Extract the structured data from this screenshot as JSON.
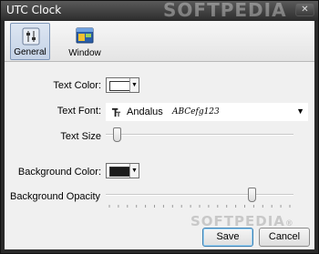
{
  "window": {
    "title": "UTC Clock",
    "close_label": "✕"
  },
  "toolbar": {
    "tabs": [
      {
        "label": "General",
        "icon": "settings-sliders-icon",
        "active": true
      },
      {
        "label": "Window",
        "icon": "window-layout-icon",
        "active": false
      }
    ]
  },
  "general": {
    "text_color_label": "Text Color:",
    "text_color_value": "#ffffff",
    "text_font_label": "Text Font:",
    "text_font_name": "Andalus",
    "text_font_preview": "ABCefg123",
    "text_size_label": "Text Size",
    "text_size_level": 0.04,
    "background_color_label": "Background Color:",
    "background_color_value": "#1a1a1a",
    "background_opacity_label": "Background Opacity",
    "background_opacity_level": 0.79
  },
  "buttons": {
    "save_label": "Save",
    "cancel_label": "Cancel"
  },
  "watermark": {
    "text": "SOFTPEDIA",
    "suffix": "®"
  },
  "colors": {
    "accent": "#3c7fb1",
    "titlebar": "#2e2e2e"
  }
}
